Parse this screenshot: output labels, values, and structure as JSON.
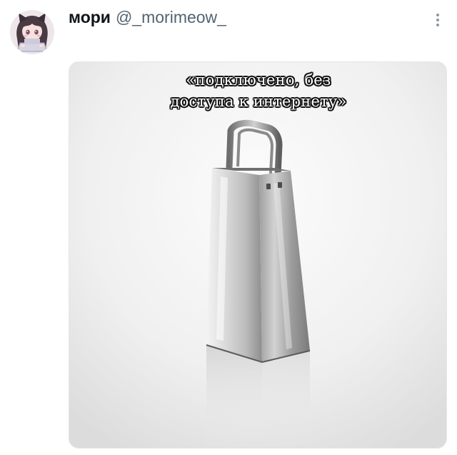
{
  "tweet": {
    "display_name": "мори",
    "handle": "@_morimeow_",
    "avatar_icon": "anime-girl-avatar-icon",
    "more_icon": "more-vertical-icon",
    "media": {
      "caption_line1": "«подключено, без",
      "caption_line2": "доступа к интернету»",
      "subject": "box-grater-image"
    }
  },
  "colors": {
    "name": "#0f1419",
    "handle": "#536471",
    "caption_fill": "#ffffff",
    "caption_outline": "#111111"
  }
}
